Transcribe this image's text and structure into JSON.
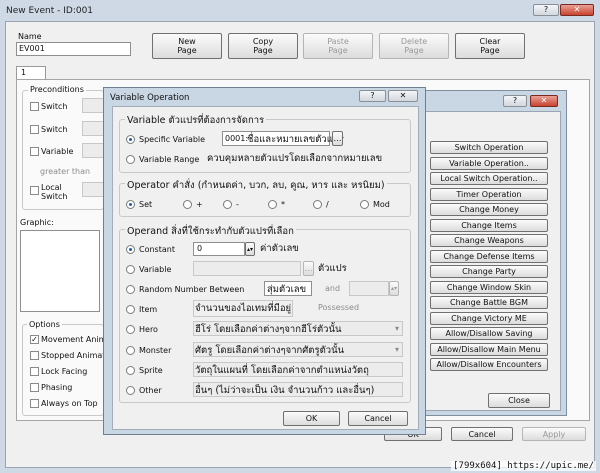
{
  "main_window": {
    "title": "New Event - ID:001",
    "name_label": "Name",
    "name_value": "EV001",
    "toolbar": {
      "new_page": "New\nPage",
      "copy_page": "Copy\nPage",
      "paste_page": "Paste\nPage",
      "delete_page": "Delete\nPage",
      "clear_page": "Clear\nPage"
    },
    "tab_label": "1",
    "preconditions": {
      "title": "Preconditions",
      "switch1": "Switch",
      "switch2": "Switch",
      "variable": "Variable",
      "greater_than": "greater than",
      "local_switch": "Local\nSwitch"
    },
    "graphic_label": "Graphic:",
    "options": {
      "title": "Options",
      "movement_anim": "Movement Animi",
      "stopped_anim": "Stopped Animat",
      "lock_facing": "Lock Facing",
      "phasing": "Phasing",
      "always_on_top": "Always on Top",
      "movement_anim_checked": true
    },
    "buttons": {
      "ok": "OK",
      "cancel": "Cancel",
      "apply": "Apply"
    },
    "title_buttons": {
      "help": "?",
      "close": "✕"
    }
  },
  "event_commands": {
    "title_buttons": {
      "help": "?",
      "close": "✕"
    },
    "buttons": [
      "Switch Operation",
      "Variable Operation..",
      "Local Switch Operation..",
      "Timer Operation",
      "Change Money",
      "Change Items",
      "Change Weapons",
      "Change Defense Items",
      "Change Party",
      "Change Window Skin",
      "Change Battle BGM",
      "Change Victory ME",
      "Allow/Disallow Saving",
      "Allow/Disallow Main Menu",
      "Allow/Disallow Encounters"
    ],
    "close": "Close"
  },
  "variable_operation": {
    "title": "Variable Operation",
    "title_buttons": {
      "help": "?",
      "close": "✕"
    },
    "variable_group": {
      "title": "Variable ตัวแปรที่ต้องการจัดการ",
      "specific": "Specific Variable",
      "specific_value": "0001:",
      "specific_note": "ชื่อและหมายเลขตัวแปร",
      "range": "Variable Range",
      "range_note": "ควบคุมหลายตัวแปรโดยเลือกจากหมายเลข"
    },
    "operator_group": {
      "title": "Operator คำสั่ง (กำหนดค่า, บวก, ลบ, คูณ, หาร และ หรนิยม)",
      "set": "Set",
      "add": "+",
      "sub": "-",
      "mul": "*",
      "div": "/",
      "mod": "Mod"
    },
    "operand_group": {
      "title": "Operand สิ่งที่ใช้กระทำกับตัวแปรที่เลือก",
      "constant": "Constant",
      "constant_value": "0",
      "constant_note": "ค่าตัวเลข",
      "variable": "Variable",
      "variable_note": "ตัวแปร",
      "random": "Random Number Between",
      "random_note": "สุ่มตัวเลข",
      "and": "and",
      "item": "Item",
      "item_note": "จำนวนของไอเทมที่มีอยู่",
      "possessed": "Possessed",
      "hero": "Hero",
      "hero_note": "ฮีโร่ โดยเลือกค่าต่างๆจากฮีโร่ตัวนั้น",
      "monster": "Monster",
      "monster_note": "ศัตรู โดยเลือกค่าต่างๆจากศัตรูตัวนั้น",
      "sprite": "Sprite",
      "sprite_note": "วัตถุในแผนที่ โดยเลือกค่าจากตำแหน่งวัตถุ",
      "other": "Other",
      "other_note": "อื่นๆ (ไม่ว่าจะเป็น เงิน จำนวนก้าว และอื่นๆ)"
    },
    "buttons": {
      "ok": "OK",
      "cancel": "Cancel"
    }
  },
  "watermark": "[799x604] https://upic.me/"
}
